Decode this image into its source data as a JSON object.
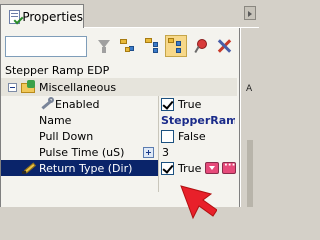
{
  "tab": {
    "label": "Properties"
  },
  "search": {
    "value": "",
    "placeholder": ""
  },
  "object_title": "Stepper Ramp EDP",
  "category": {
    "label": "Miscellaneous"
  },
  "properties": [
    {
      "name": "Enabled",
      "value": "True",
      "kind": "checkbox",
      "checked": true
    },
    {
      "name": "Name",
      "value": "StepperRamp...",
      "kind": "text-bold"
    },
    {
      "name": "Pull Down",
      "value": "False",
      "kind": "checkbox",
      "checked": false
    },
    {
      "name": "Pulse Time (uS)",
      "value": "3",
      "kind": "expandable"
    },
    {
      "name": "Return Type (Dir)",
      "value": "True",
      "kind": "checkbox-with-buttons",
      "checked": true,
      "selected": true
    }
  ],
  "side": {
    "letter": "A"
  },
  "icons": [
    "filter-icon",
    "categorized-icon",
    "alphabetical-icon",
    "property-pages-icon",
    "pin-icon",
    "tools-icon",
    "wrench-icon",
    "pencil-icon"
  ],
  "colors": {
    "selection": "#0a246a",
    "pointer": "#e8202a",
    "accent_button": "#e64a7a"
  }
}
